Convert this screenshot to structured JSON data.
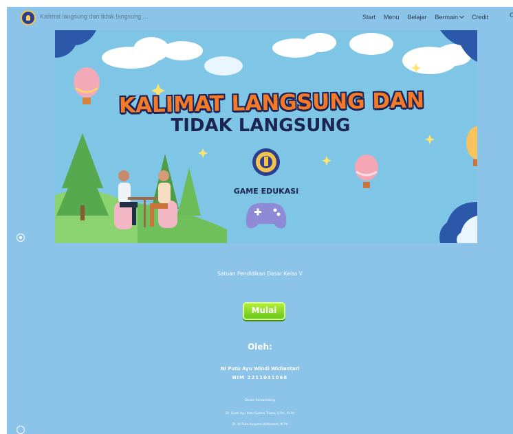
{
  "header": {
    "site_title": "Kalimat langsung dan tidak langsung ...",
    "nav": [
      {
        "label": "Start"
      },
      {
        "label": "Menu"
      },
      {
        "label": "Belajar"
      },
      {
        "label": "Bermain"
      },
      {
        "label": "Credit"
      }
    ],
    "nav_more": "C"
  },
  "banner": {
    "title_line1": "KALIMAT LANGSUNG DAN",
    "title_line2": "TIDAK LANGSUNG",
    "caption": "GAME EDUKASI"
  },
  "content": {
    "subject": "Satuan Pendidikan Dasar Kelas V",
    "start_button": "Mulai",
    "by_label": "Oleh:",
    "author": "Ni Putu Ayu Windi Widiantari",
    "nim": "NIM 2211031068",
    "advisor_title": "Dosen Pembimbing",
    "advisor1": "Dr. Gusti Ayu Putu Sukma Trisna, S.Pd., M.Pd",
    "advisor2": "Dr. Ni Putu Kusuma Widiastuti, M.Pd"
  },
  "colors": {
    "page_bg": "#8cc3e9",
    "title_orange": "#f47a29",
    "title_navy": "#1c2452",
    "button_green": "#7ad61f"
  },
  "icons": [
    "university-logo-icon",
    "chevron-down-icon",
    "circle-icon",
    "gamepad-icon",
    "hot-air-balloon-icon"
  ]
}
